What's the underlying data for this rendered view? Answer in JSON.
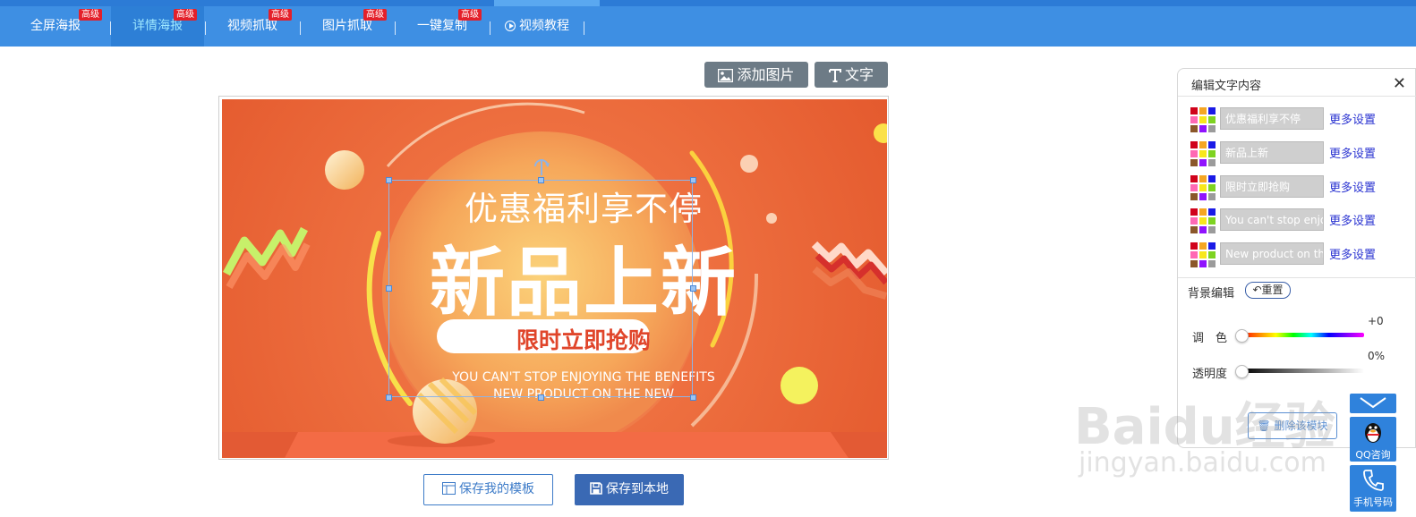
{
  "nav": {
    "items": [
      {
        "label": "全屏海报",
        "badge": "高级"
      },
      {
        "label": "详情海报",
        "badge": "高级"
      },
      {
        "label": "视频抓取",
        "badge": "高级"
      },
      {
        "label": "图片抓取",
        "badge": "高级"
      },
      {
        "label": "一键复制",
        "badge": "高级"
      },
      {
        "label": "视频教程",
        "badge": ""
      }
    ],
    "active_index": 1
  },
  "toolbar": {
    "add_image_label": "添加图片",
    "text_label": "文字"
  },
  "poster": {
    "line1": "优惠福利享不停",
    "headline": "新品上新",
    "button_text": "限时立即抢购",
    "en_line1": "YOU CAN'T STOP ENJOYING THE BENEFITS",
    "en_line2": "NEW PRODUCT ON THE NEW"
  },
  "actions": {
    "save_template_label": "保存我的模板",
    "save_local_label": "保存到本地"
  },
  "panel": {
    "title": "编辑文字内容",
    "text_entries": [
      {
        "value": "优惠福利享不停",
        "more": "更多设置"
      },
      {
        "value": "新品上新",
        "more": "更多设置"
      },
      {
        "value": "限时立即抢购",
        "more": "更多设置"
      },
      {
        "value": "You can't stop enjo",
        "more": "更多设置"
      },
      {
        "value": "New product on the",
        "more": "更多设置"
      }
    ],
    "swatch_colors": [
      "#d0021b",
      "#f5a623",
      "#1a1ae6",
      "#ff69b4",
      "#f8e71c",
      "#7ed321",
      "#8b572a",
      "#9013fe",
      "#9b9b9b"
    ],
    "bg_title": "背景编辑",
    "reset_label": "重置",
    "hue_label": "调　色",
    "hue_value": "+0",
    "opacity_label": "透明度",
    "opacity_value": "0%",
    "delete_label": "删除该模块"
  },
  "side": {
    "qq_label": "QQ咨询",
    "phone_label": "手机号码"
  },
  "watermark": {
    "main": "Baidu经验",
    "sub": "jingyan.baidu.com"
  },
  "colors": {
    "nav_bg": "#3e8fe3",
    "nav_active": "#2d7fd6",
    "badge": "#e4202a",
    "poster_orange": "#ee7040",
    "poster_button_text": "#e0452a",
    "primary_button": "#3a69b4",
    "link": "#2a33d1"
  }
}
